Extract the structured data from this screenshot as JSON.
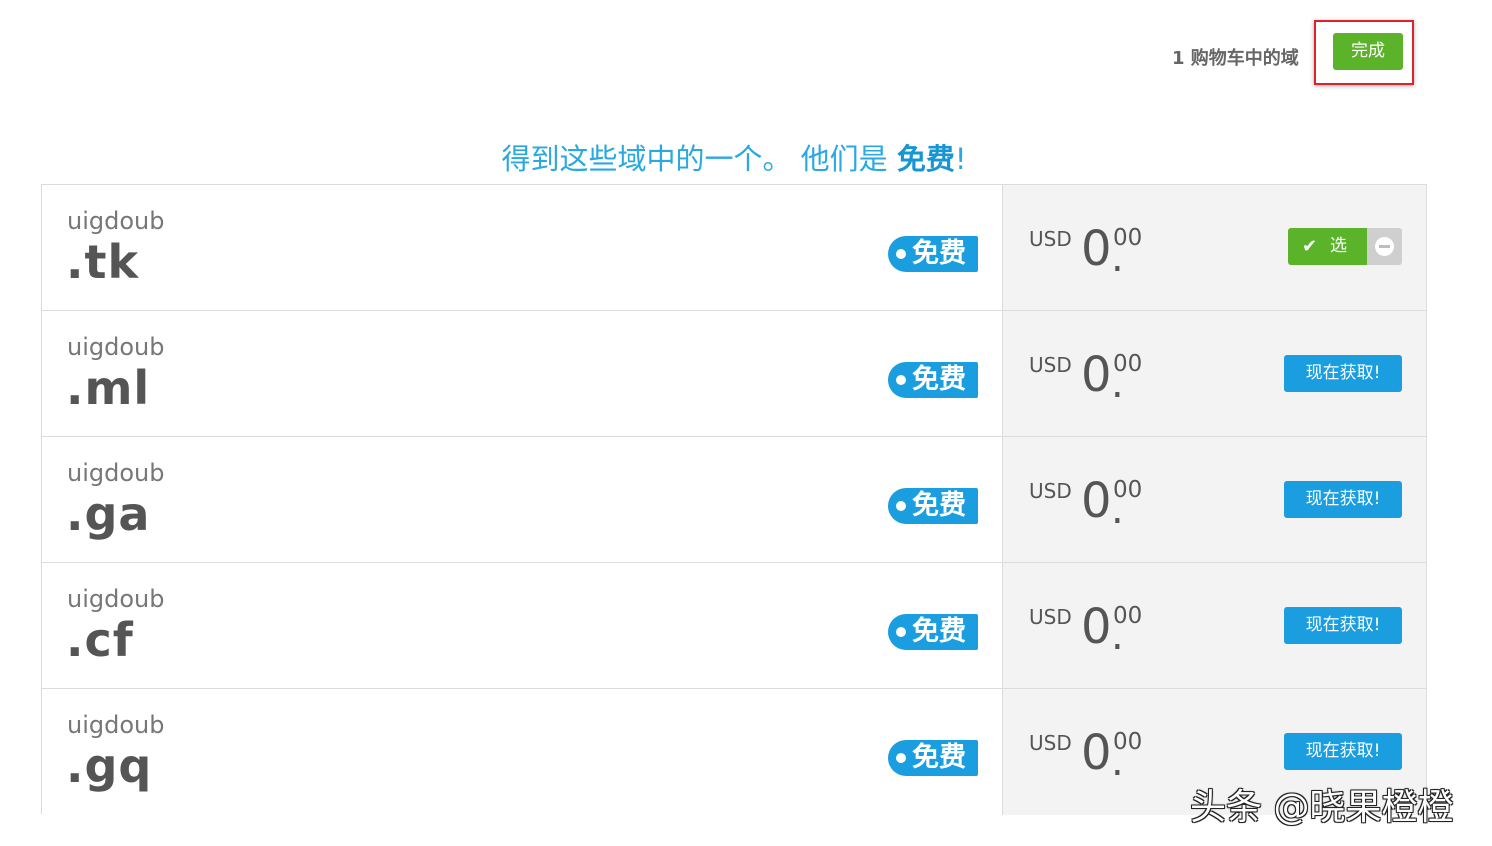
{
  "header": {
    "cart_count_text": "1 购物车中的域",
    "done_label": "完成"
  },
  "headline": {
    "prefix": "得到这些域中的一个。 他们是 ",
    "emphasis": "免费",
    "suffix": "!"
  },
  "domains": [
    {
      "name": "uigdoub",
      "tld": ".tk",
      "badge": "免费",
      "currency": "USD",
      "price_int": "0",
      "price_dot": ".",
      "price_cents": "00",
      "action": "选",
      "selected": true
    },
    {
      "name": "uigdoub",
      "tld": ".ml",
      "badge": "免费",
      "currency": "USD",
      "price_int": "0",
      "price_dot": ".",
      "price_cents": "00",
      "action": "现在获取!",
      "selected": false
    },
    {
      "name": "uigdoub",
      "tld": ".ga",
      "badge": "免费",
      "currency": "USD",
      "price_int": "0",
      "price_dot": ".",
      "price_cents": "00",
      "action": "现在获取!",
      "selected": false
    },
    {
      "name": "uigdoub",
      "tld": ".cf",
      "badge": "免费",
      "currency": "USD",
      "price_int": "0",
      "price_dot": ".",
      "price_cents": "00",
      "action": "现在获取!",
      "selected": false
    },
    {
      "name": "uigdoub",
      "tld": ".gq",
      "badge": "免费",
      "currency": "USD",
      "price_int": "0",
      "price_dot": ".",
      "price_cents": "00",
      "action": "现在获取!",
      "selected": false
    }
  ],
  "watermark": "头条 @晓果橙橙",
  "colors": {
    "accent_blue": "#1a9ee0",
    "accent_green": "#5bb32a",
    "highlight_red": "#d6262c"
  },
  "icons": {
    "selected": "check-icon",
    "remove": "minus-circle-icon"
  }
}
